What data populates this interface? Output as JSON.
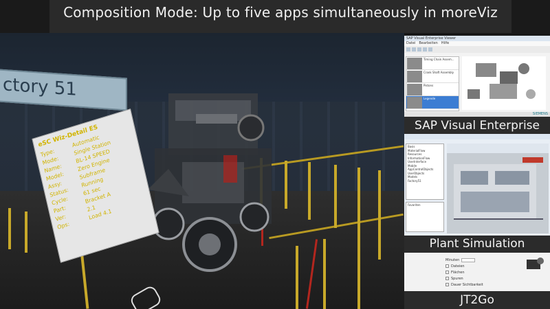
{
  "caption": "Composition Mode: Up to five apps simultaneously in moreViz",
  "viewport": {
    "factory_sign": "ctory 51",
    "info_panel": {
      "title": "eSC Wiz-Detail ES",
      "rows": [
        {
          "key": "Type:",
          "value": "Automatic"
        },
        {
          "key": "Mode:",
          "value": "Single Station"
        },
        {
          "key": "Name:",
          "value": "BL-14 SPEED"
        },
        {
          "key": "Model:",
          "value": "Zero Engine"
        },
        {
          "key": "Assy:",
          "value": "Subframe"
        },
        {
          "key": "Status:",
          "value": "Running"
        },
        {
          "key": "Cycle:",
          "value": "61 sec"
        },
        {
          "key": "Part:",
          "value": "Bracket A"
        },
        {
          "key": "Ver:",
          "value": "2.1"
        },
        {
          "key": "Ops:",
          "value": "Load 4.1"
        }
      ]
    }
  },
  "panels": {
    "sap": {
      "label": "SAP Visual Enterprise",
      "window_title": "SAP Visual Enterprise Viewer",
      "menu": [
        "Datei",
        "Bearbeiten",
        "Hilfe"
      ],
      "list": [
        {
          "text": "Timing Chain Assem..."
        },
        {
          "text": "Crank Shaft Assembly"
        },
        {
          "text": "Pistons"
        },
        {
          "text": "Legende"
        }
      ],
      "brand": "SIEMENS"
    },
    "plant": {
      "label": "Plant Simulation",
      "tree_items": [
        "Basis",
        "MaterialFlow",
        "Resources",
        "InformationFlow",
        "UserInterface",
        "Mobile",
        "AppControlObjects",
        "UserObjects",
        "Models",
        "Factory51"
      ],
      "tree2_title": "Favoriten"
    },
    "jt": {
      "label": "JT2Go",
      "fields": [
        "Minuten",
        "Dateien",
        "Flächen",
        "Spuren",
        "Dauer Sichtbarkeit"
      ]
    }
  }
}
